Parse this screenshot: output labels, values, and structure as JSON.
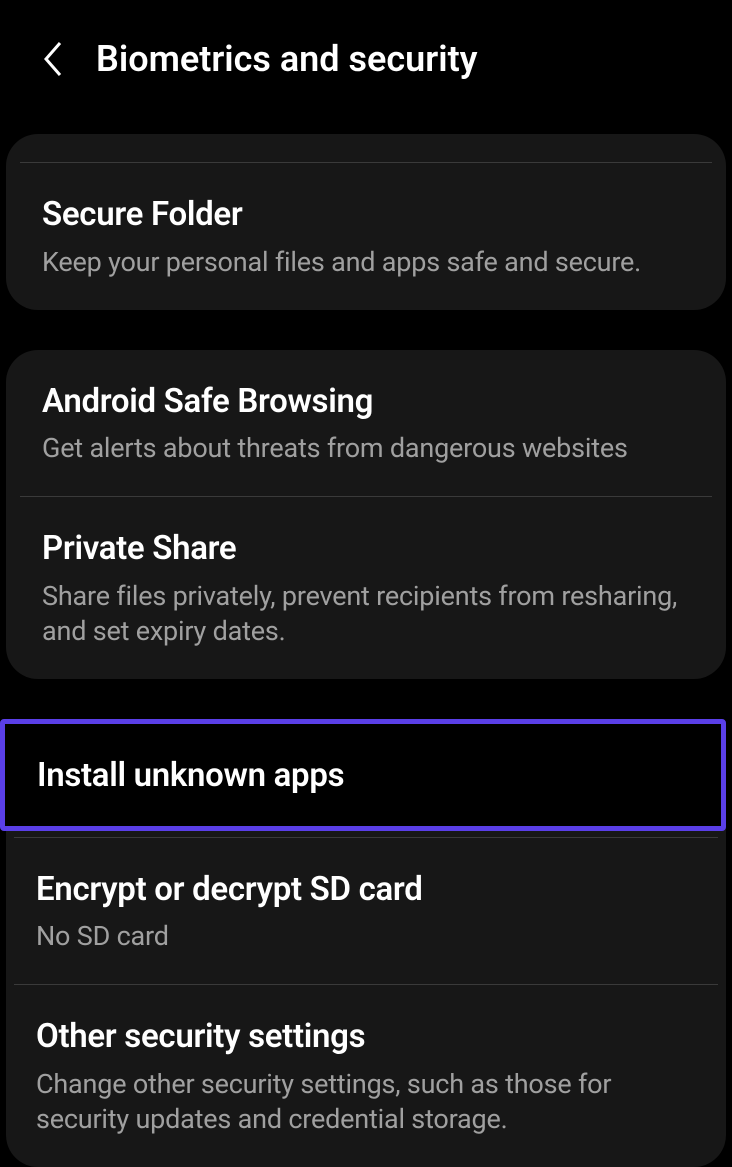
{
  "header": {
    "title": "Biometrics and security"
  },
  "section1": {
    "items": [
      {
        "title": "Secure Folder",
        "desc": "Keep your personal files and apps safe and secure."
      }
    ]
  },
  "section2": {
    "items": [
      {
        "title": "Android Safe Browsing",
        "desc": "Get alerts about threats from dangerous websites"
      },
      {
        "title": "Private Share",
        "desc": "Share files privately, prevent recipients from resharing, and set expiry dates."
      }
    ]
  },
  "section3": {
    "items": [
      {
        "title": "Install unknown apps"
      },
      {
        "title": "Encrypt or decrypt SD card",
        "desc": "No SD card"
      },
      {
        "title": "Other security settings",
        "desc": "Change other security settings, such as those for security updates and credential storage."
      }
    ]
  }
}
